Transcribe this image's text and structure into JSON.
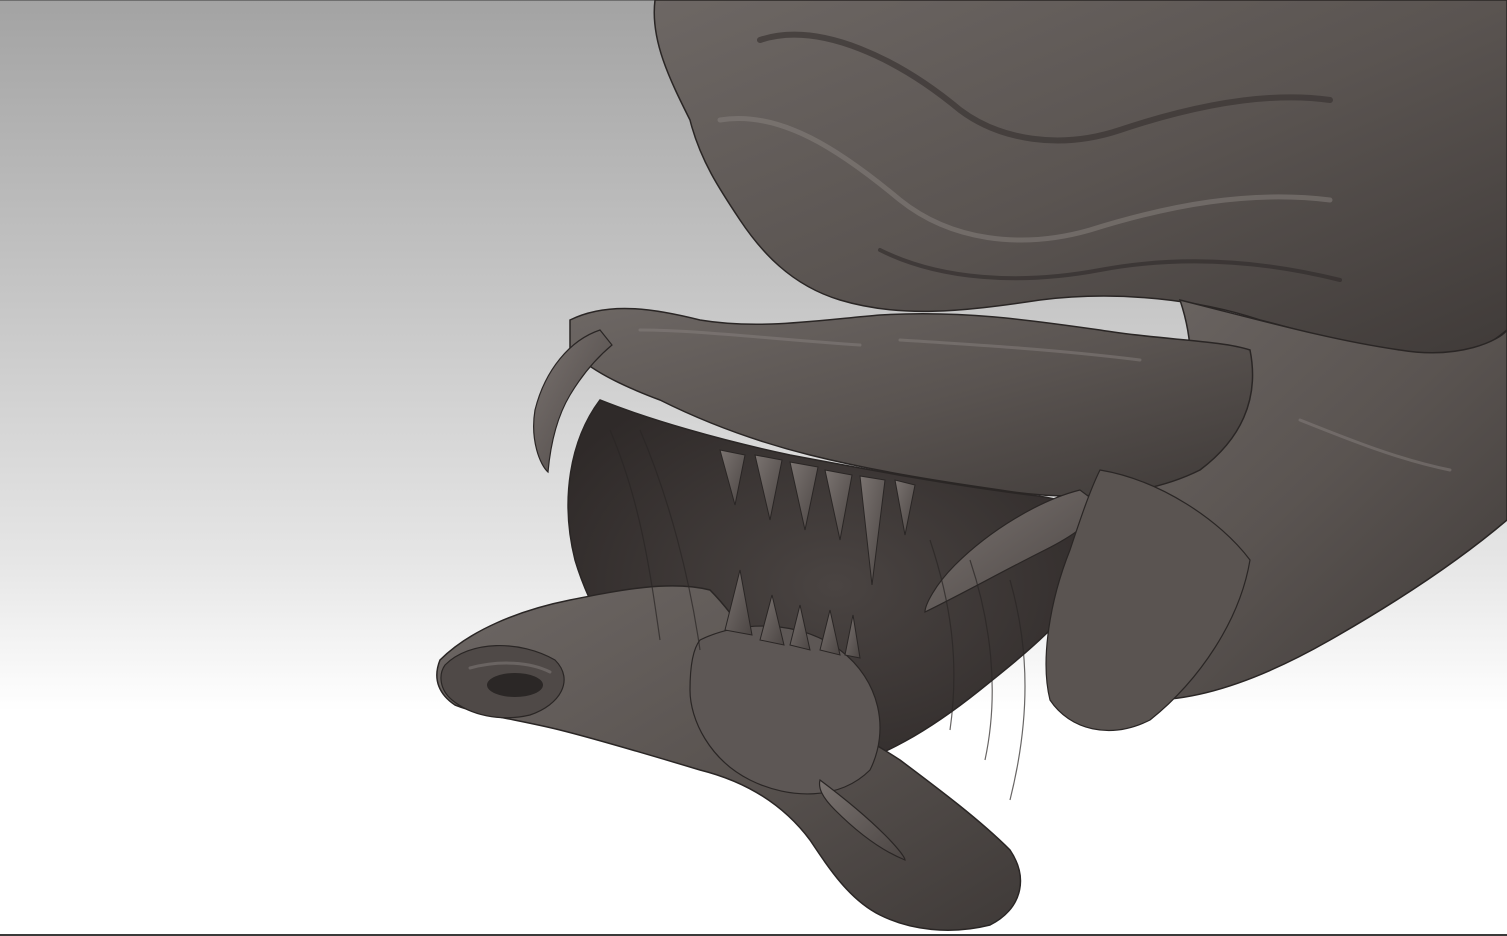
{
  "viewport": {
    "subject": "sculpt-model",
    "background_top_color": "#a3a3a3",
    "background_bottom_color": "#ffffff",
    "model_color": "#5e5957",
    "model_shadow_color": "#2e2a29",
    "model_highlight_color": "#8a8380"
  }
}
